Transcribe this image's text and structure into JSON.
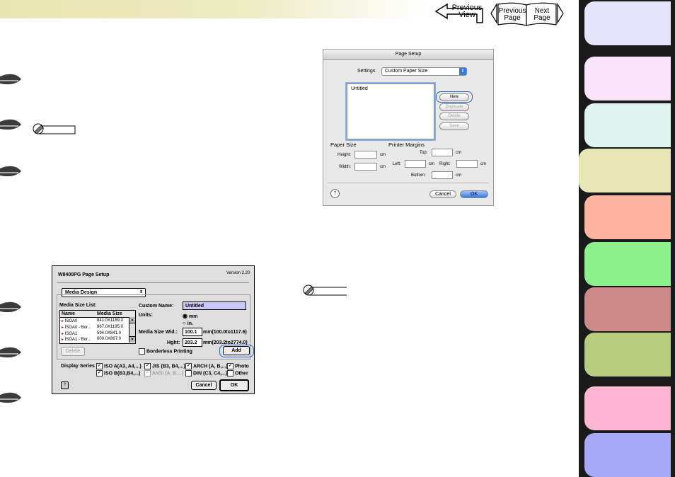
{
  "nav": {
    "previous_view_line1": "Previous",
    "previous_view_line2": "View",
    "previous_page_line1": "Previous",
    "previous_page_line2": "Page",
    "next_page_line1": "Next",
    "next_page_line2": "Page"
  },
  "colors": {
    "tabs": [
      "#e4e4fb",
      "#fbe4fb",
      "#dff3f0",
      "#e8e6b4",
      "#ffb4a0",
      "#8cf08c",
      "#cc8a8a",
      "#b8cc80",
      "#ffb4d0",
      "#a8a8f8"
    ],
    "highlight": "#2a66c8"
  },
  "page_setup_dialog": {
    "title": "Page Setup",
    "settings_label": "Settings:",
    "settings_value": "Custom Paper Size",
    "list_item": "Untitled",
    "buttons": {
      "new": "New",
      "duplicate": "Duplicate",
      "delete": "Delete",
      "save": "Save",
      "cancel": "Cancel",
      "ok": "OK"
    },
    "paper_size_label": "Paper Size",
    "height_label": "Height:",
    "width_label": "Width:",
    "unit": "cm",
    "printer_margins_label": "Printer Margins",
    "top_label": "Top:",
    "left_label": "Left:",
    "right_label": "Right:",
    "bottom_label": "Bottom:",
    "help_icon": "?"
  },
  "os9_dialog": {
    "title": "W8400PG Page Setup",
    "version": "Version 2.20",
    "popup": "Media Design",
    "media_size_list_label": "Media Size List:",
    "col_name": "Name",
    "col_size": "Media Size",
    "rows": [
      {
        "name": "ISOA0",
        "size": "841.0X1189.0"
      },
      {
        "name": "ISOA0 - Bor...",
        "size": "867.0X1195.0"
      },
      {
        "name": "ISOA1",
        "size": "594.0X841.0"
      },
      {
        "name": "ISOA1 - Bor...",
        "size": "600.0X867.0"
      }
    ],
    "custom_name_label": "Custom Name:",
    "custom_name_value": "Untitled",
    "units_label": "Units:",
    "unit_mm": "mm",
    "unit_in": "in.",
    "width_label": "Media Size Wid.:",
    "width_value": "100.1",
    "width_range": "mm(100.0to1117.6)",
    "height_label": "Hght:",
    "height_value": "203.2",
    "height_range": "mm(203.2to2774.0)",
    "delete_btn": "Delete",
    "borderless_label": "Borderless Printing",
    "add_btn": "Add",
    "display_series_label": "Display Series",
    "series": [
      "ISO A(A3, A4,...)",
      "JIS (B3, B4,...)",
      "ARCH (A, B,...)",
      "Photo",
      "ISO B(B3,B4,...)",
      "ANSI (A, B,...)",
      "DIN (C3, C4,...)",
      "Other"
    ],
    "cancel_btn": "Cancel",
    "ok_btn": "OK",
    "help_icon": "?"
  }
}
